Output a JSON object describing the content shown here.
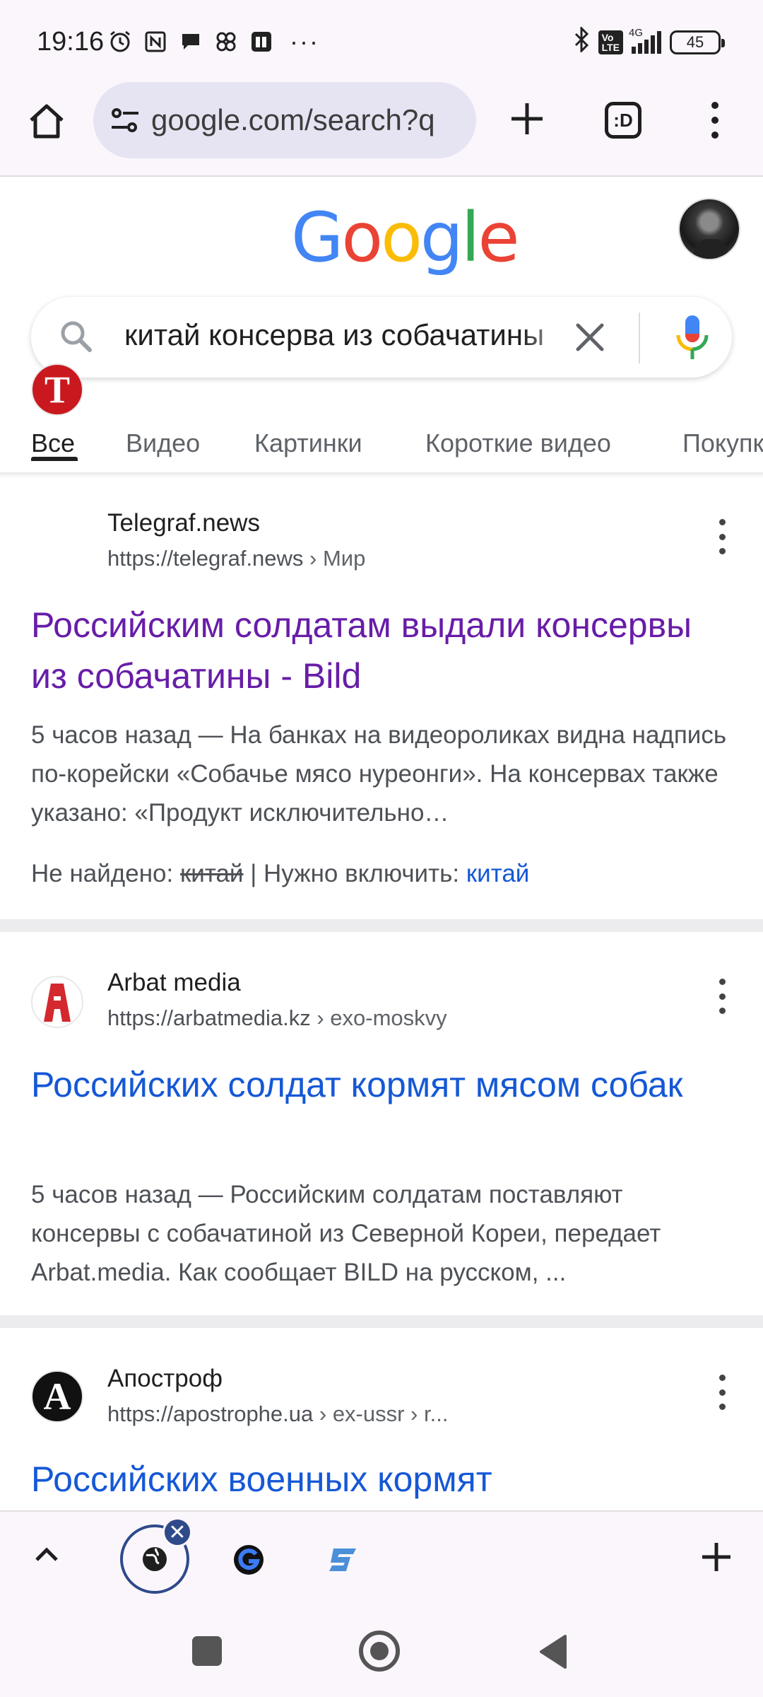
{
  "status_bar": {
    "time": "19:16",
    "battery": "45",
    "network": "4G"
  },
  "browser": {
    "url": "google.com/search?q",
    "tabs_icon_label": ":D"
  },
  "search": {
    "query": "китай консерва из собачатины"
  },
  "tabs": [
    {
      "label": "Все",
      "active": true
    },
    {
      "label": "Видео",
      "active": false
    },
    {
      "label": "Картинки",
      "active": false
    },
    {
      "label": "Короткие видео",
      "active": false
    },
    {
      "label": "Покупки",
      "active": false
    }
  ],
  "results": [
    {
      "site": "Telegraf.news",
      "url": "https://telegraf.news",
      "breadcrumb": " › Мир",
      "title": "Российским солдатам выдали консервы из собачатины - Bild",
      "visited": true,
      "snippet": "5 часов назад — На банках на видеороликах видна надпись по-корейски «Собачье мясо нуреонги». На консервах также указано: «Продукт исключительно…",
      "missing_label": "Не найдено: ",
      "missing_term": "китай",
      "must_include_label": " | Нужно включить: ",
      "must_include_term": "китай"
    },
    {
      "site": "Arbat media",
      "url": "https://arbatmedia.kz",
      "breadcrumb": " › exo-moskvy",
      "title": "Российских солдат кормят мясом собак",
      "visited": false,
      "snippet": "5 часов назад — Российским солдатам поставляют консервы с собачатиной из Северной Кореи, передает Arbat.media. Как сообщает BILD на русском, ..."
    },
    {
      "site": "Апостроф",
      "url": "https://apostrophe.ua",
      "breadcrumb": " › ex-ussr › r...",
      "title": "Российских военных кормят",
      "visited": false
    }
  ],
  "colors": {
    "visited_link": "#681da8",
    "link": "#1558d6",
    "google_blue": "#4285f4",
    "google_red": "#ea4335",
    "google_yellow": "#fbbc05",
    "google_green": "#34a853"
  }
}
